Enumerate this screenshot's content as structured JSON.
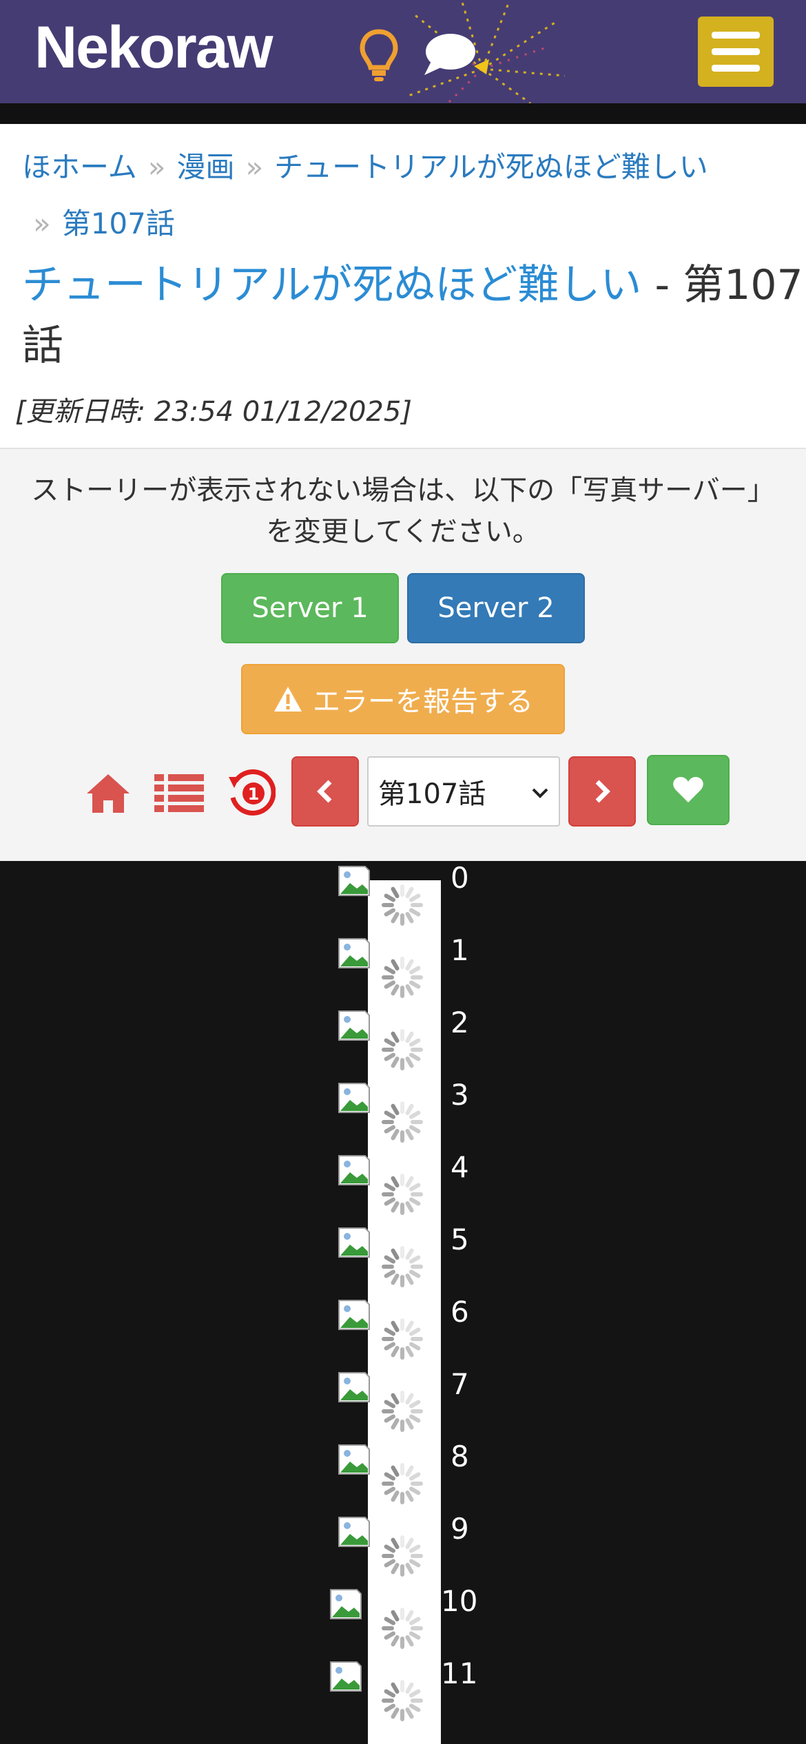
{
  "header": {
    "logo": "Nekoraw",
    "bulb_icon": "lightbulb-icon",
    "chat_icon": "chat-bubble-icon",
    "menu_icon": "hamburger-menu-icon",
    "colors": {
      "bar": "#463c74",
      "menu": "#d4b11f"
    }
  },
  "breadcrumb": {
    "home": "ほホーム",
    "manga": "漫画",
    "series": "チュートリアルが死ぬほど難しい",
    "chapter": "第107話",
    "separator": "»"
  },
  "title": {
    "series_link": "チュートリアルが死ぬほど難しい",
    "suffix": " - 第107話"
  },
  "updated": "[更新日時: 23:54 01/12/2025]",
  "notice": "ストーリーが表示されない場合は、以下の「写真サーバー」を変更してください。",
  "buttons": {
    "server1": "Server 1",
    "server2": "Server 2",
    "report": "エラーを報告する"
  },
  "nav": {
    "chapter_selected": "第107話",
    "history_badge": "1"
  },
  "pages": [
    "0",
    "1",
    "2",
    "3",
    "4",
    "5",
    "6",
    "7",
    "8",
    "9",
    "10",
    "11"
  ]
}
